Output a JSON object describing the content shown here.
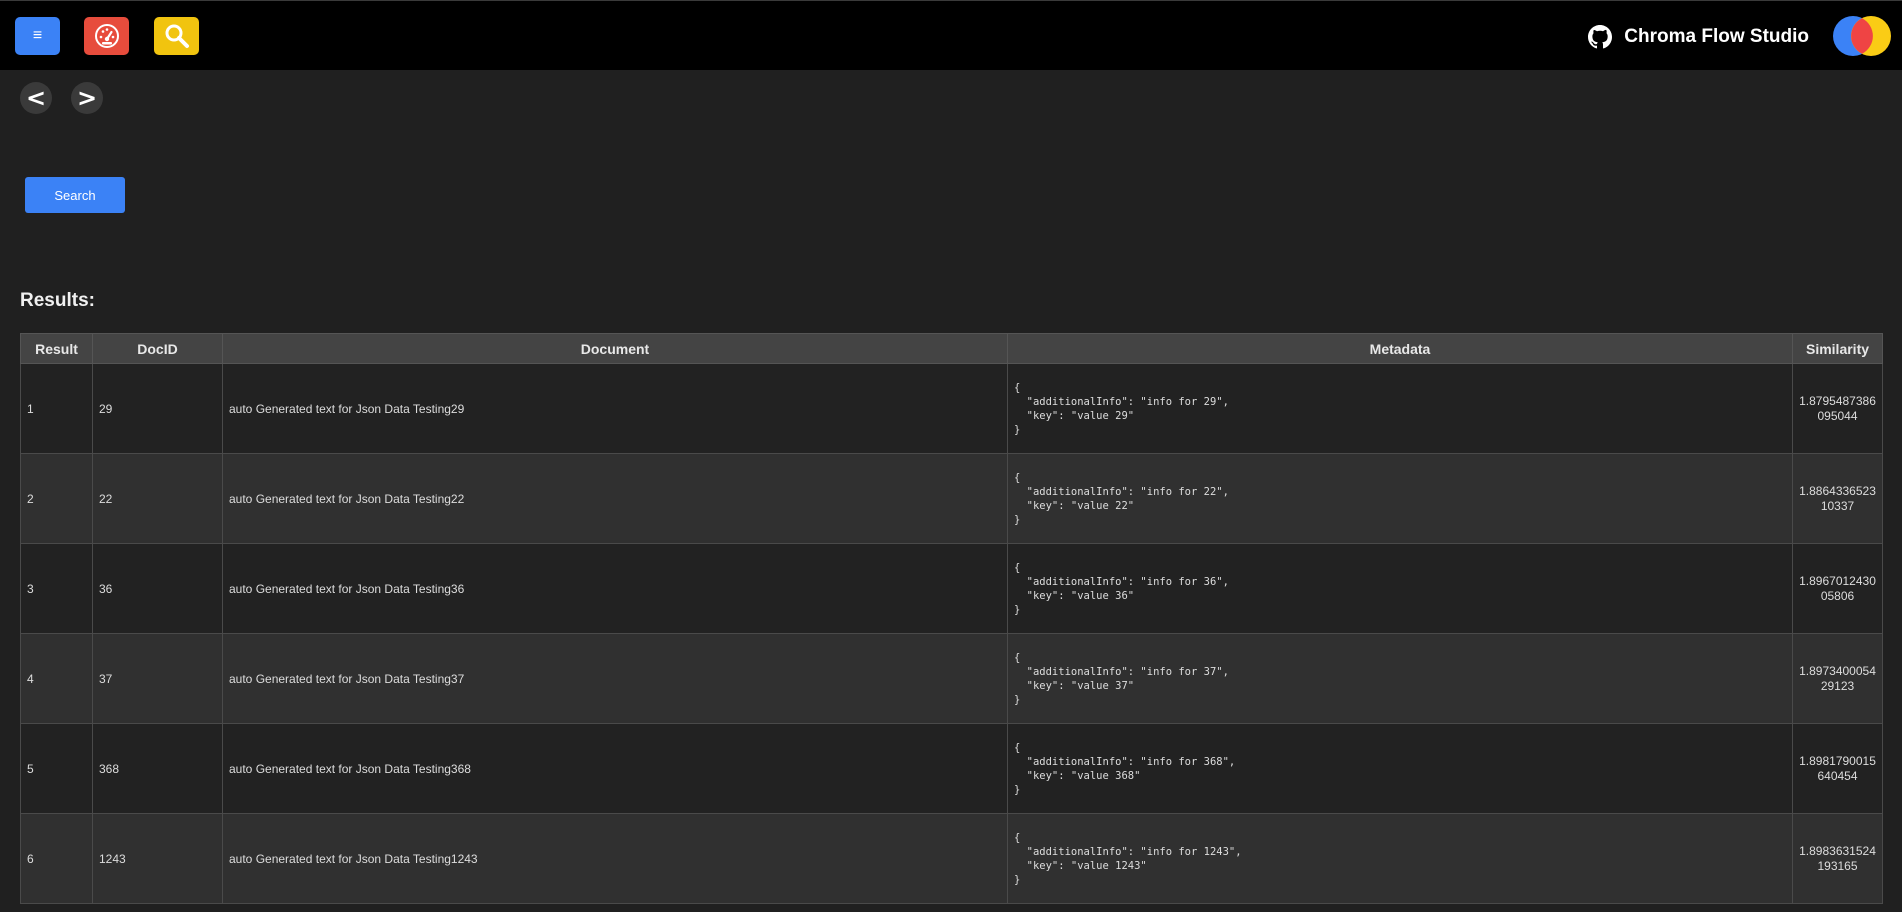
{
  "header": {
    "brand_title": "Chroma Flow Studio",
    "nav_buttons": [
      {
        "name": "menu",
        "icon": "hamburger-icon",
        "glyph": "≡",
        "color": "#3b82f6"
      },
      {
        "name": "dashboard",
        "icon": "gauge-icon",
        "color": "#e74c3c"
      },
      {
        "name": "search",
        "icon": "magnifier-icon",
        "color": "#f1c40f"
      }
    ],
    "github_icon": "github-icon",
    "logo_colors": [
      "#3b82f6",
      "#ef4444",
      "#facc15"
    ]
  },
  "history": {
    "back_label": "<",
    "forward_label": ">"
  },
  "search": {
    "button_label": "Search"
  },
  "results": {
    "title": "Results:",
    "columns": [
      "Result",
      "DocID",
      "Document",
      "Metadata",
      "Similarity"
    ],
    "rows": [
      {
        "result": "1",
        "docid": "29",
        "document": "auto Generated text for Json Data Testing29",
        "metadata": "{\n  \"additionalInfo\": \"info for 29\",\n  \"key\": \"value 29\"\n}",
        "similarity": "1.8795487386095044"
      },
      {
        "result": "2",
        "docid": "22",
        "document": "auto Generated text for Json Data Testing22",
        "metadata": "{\n  \"additionalInfo\": \"info for 22\",\n  \"key\": \"value 22\"\n}",
        "similarity": "1.886433652310337"
      },
      {
        "result": "3",
        "docid": "36",
        "document": "auto Generated text for Json Data Testing36",
        "metadata": "{\n  \"additionalInfo\": \"info for 36\",\n  \"key\": \"value 36\"\n}",
        "similarity": "1.896701243005806"
      },
      {
        "result": "4",
        "docid": "37",
        "document": "auto Generated text for Json Data Testing37",
        "metadata": "{\n  \"additionalInfo\": \"info for 37\",\n  \"key\": \"value 37\"\n}",
        "similarity": "1.897340005429123"
      },
      {
        "result": "5",
        "docid": "368",
        "document": "auto Generated text for Json Data Testing368",
        "metadata": "{\n  \"additionalInfo\": \"info for 368\",\n  \"key\": \"value 368\"\n}",
        "similarity": "1.8981790015640454"
      },
      {
        "result": "6",
        "docid": "1243",
        "document": "auto Generated text for Json Data Testing1243",
        "metadata": "{\n  \"additionalInfo\": \"info for 1243\",\n  \"key\": \"value 1243\"\n}",
        "similarity": "1.8983631524193165"
      }
    ]
  }
}
